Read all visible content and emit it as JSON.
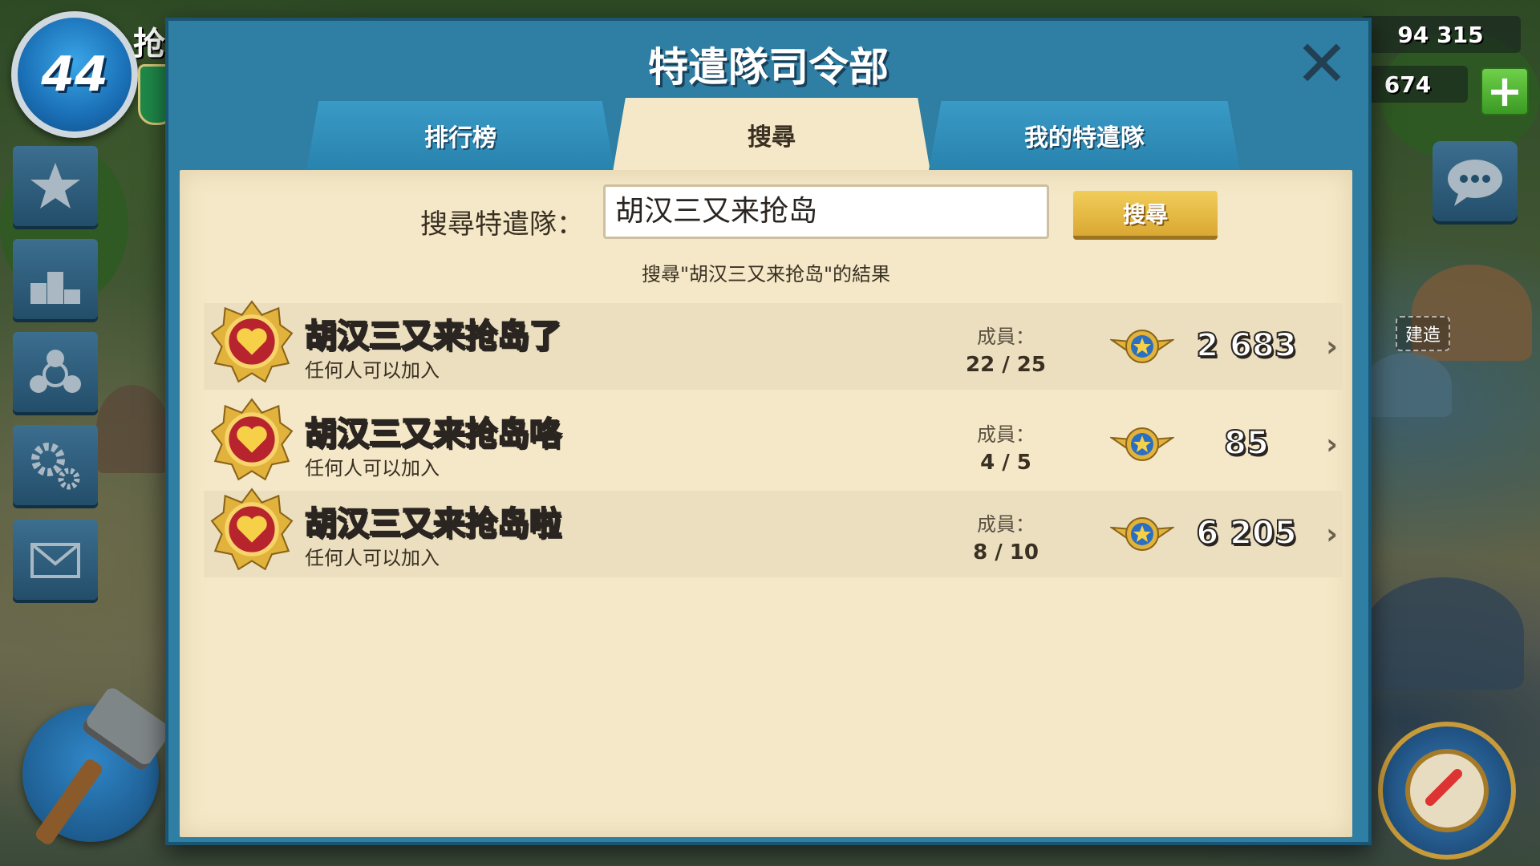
{
  "hud": {
    "level": "44",
    "player_name": "抢",
    "resources": {
      "top_value": "94 315",
      "second_value": "674"
    },
    "side_buttons": [
      "star-icon",
      "leaderboard-icon",
      "taskforce-icon",
      "settings-icon",
      "mail-icon"
    ],
    "build_label": "建造"
  },
  "dialog": {
    "title": "特遣隊司令部",
    "tabs": [
      {
        "label": "排行榜",
        "active": false
      },
      {
        "label": "搜尋",
        "active": true
      },
      {
        "label": "我的特遣隊",
        "active": false
      }
    ],
    "search": {
      "label": "搜尋特遣隊：",
      "value": "胡汉三又来抢岛",
      "button_label": "搜尋",
      "results_caption": "搜尋\"胡汉三又来抢岛\"的結果"
    },
    "results": [
      {
        "name": "胡汉三又来抢岛了",
        "status": "任何人可以加入",
        "members_label": "成員：",
        "members": "22 / 25",
        "score": "2 683"
      },
      {
        "name": "胡汉三又来抢岛咯",
        "status": "任何人可以加入",
        "members_label": "成員：",
        "members": "4 / 5",
        "score": "85"
      },
      {
        "name": "胡汉三又来抢岛啦",
        "status": "任何人可以加入",
        "members_label": "成員：",
        "members": "8 / 10",
        "score": "6 205"
      }
    ]
  },
  "colors": {
    "dialog_blue": "#2f7ea3",
    "panel_parchment": "#f4e8c8",
    "search_button_gold": "#e4b844",
    "plus_green": "#4fb530"
  }
}
